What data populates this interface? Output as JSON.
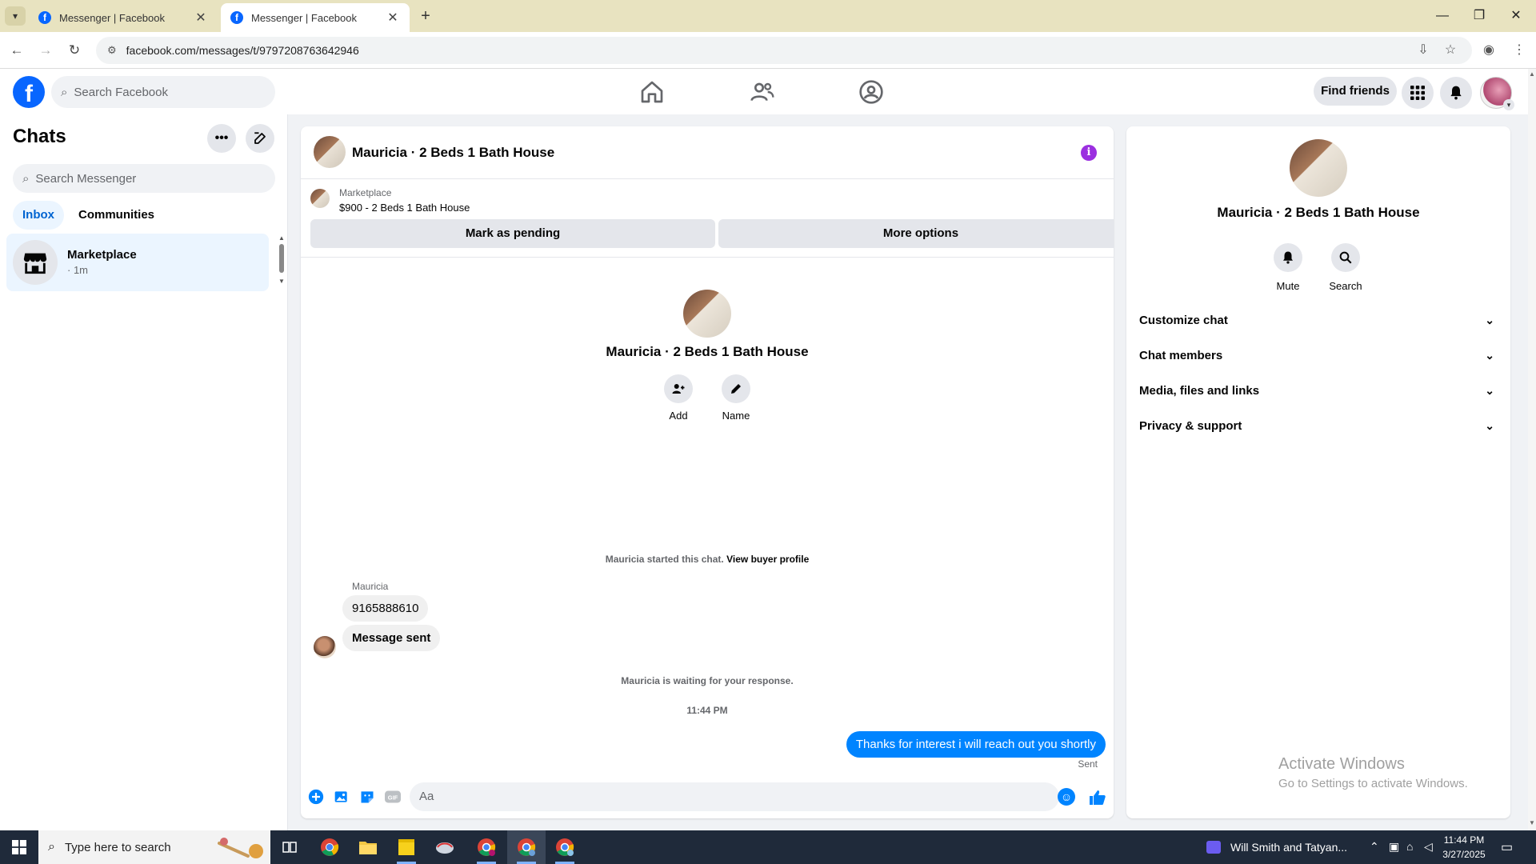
{
  "browser": {
    "tabs": [
      {
        "title": "Messenger | Facebook"
      },
      {
        "title": "Messenger | Facebook"
      }
    ],
    "url": "facebook.com/messages/t/9797208763642946"
  },
  "fb_nav": {
    "search_placeholder": "Search Facebook",
    "find_friends_label": "Find friends"
  },
  "sidebar": {
    "title": "Chats",
    "search_placeholder": "Search Messenger",
    "tabs": [
      {
        "label": "Inbox",
        "active": true
      },
      {
        "label": "Communities",
        "active": false
      }
    ],
    "chats": [
      {
        "name": "Marketplace",
        "subtitle": "· 1m"
      }
    ]
  },
  "conversation": {
    "title": "Mauricia · 2 Beds 1 Bath House",
    "listing": {
      "source": "Marketplace",
      "title": "$900 - 2 Beds 1 Bath House",
      "buttons": [
        "Mark as pending",
        "More options"
      ]
    },
    "intro": {
      "name": "Mauricia · 2 Beds 1 Bath House",
      "actions": [
        {
          "label": "Add",
          "icon": "add-person-icon"
        },
        {
          "label": "Name",
          "icon": "pencil-icon"
        }
      ]
    },
    "started_text": "Mauricia started this chat.",
    "view_profile_link": "View buyer profile",
    "messages_in": {
      "sender": "Mauricia",
      "bubbles": [
        "9165888610",
        "Message sent"
      ]
    },
    "waiting_text": "Mauricia is waiting for your response.",
    "timestamp": "11:44 PM",
    "message_out": "Thanks for interest i will reach out you shortly",
    "sent_label": "Sent",
    "composer_placeholder": "Aa"
  },
  "info_panel": {
    "name": "Mauricia · 2 Beds 1 Bath House",
    "actions": [
      {
        "label": "Mute",
        "icon": "bell-icon"
      },
      {
        "label": "Search",
        "icon": "search-icon"
      }
    ],
    "sections": [
      "Customize chat",
      "Chat members",
      "Media, files and links",
      "Privacy & support"
    ]
  },
  "watermark": {
    "line1": "Activate Windows",
    "line2": "Go to Settings to activate Windows."
  },
  "taskbar": {
    "search_placeholder": "Type here to search",
    "media_title": "Will Smith and Tatyan...",
    "time": "11:44 PM",
    "date": "3/27/2025"
  },
  "colors": {
    "fb_blue": "#0866ff",
    "messenger_blue": "#0084ff",
    "active_chat_bg": "#ebf5ff",
    "info_purple": "#9b2fe0",
    "browser_tabbar": "#e8e3c0"
  }
}
